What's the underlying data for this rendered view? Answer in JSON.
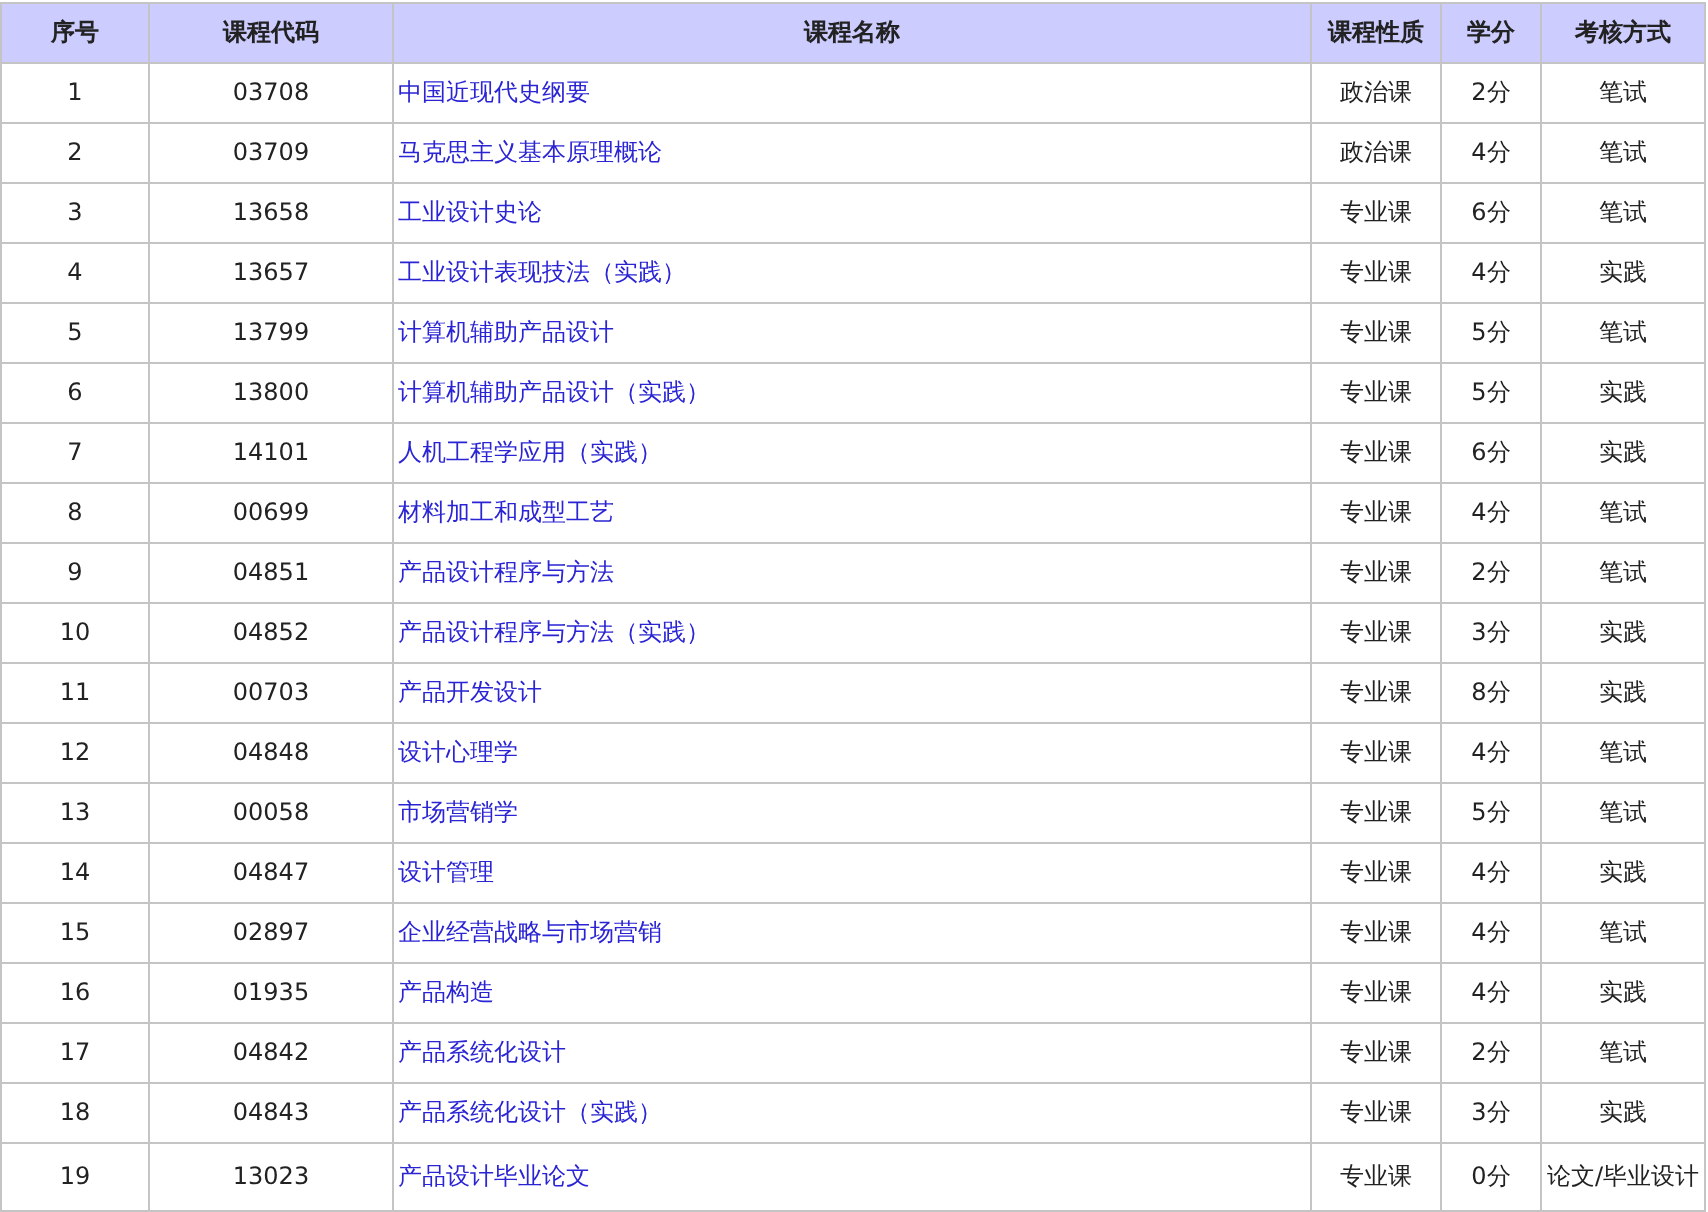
{
  "table": {
    "columns": [
      "序号",
      "课程代码",
      "课程名称",
      "课程性质",
      "学分",
      "考核方式"
    ],
    "rows": [
      [
        "1",
        "03708",
        "中国近现代史纲要",
        "政治课",
        "2分",
        "笔试"
      ],
      [
        "2",
        "03709",
        "马克思主义基本原理概论",
        "政治课",
        "4分",
        "笔试"
      ],
      [
        "3",
        "13658",
        "工业设计史论",
        "专业课",
        "6分",
        "笔试"
      ],
      [
        "4",
        "13657",
        "工业设计表现技法（实践）",
        "专业课",
        "4分",
        "实践"
      ],
      [
        "5",
        "13799",
        "计算机辅助产品设计",
        "专业课",
        "5分",
        "笔试"
      ],
      [
        "6",
        "13800",
        "计算机辅助产品设计（实践）",
        "专业课",
        "5分",
        "实践"
      ],
      [
        "7",
        "14101",
        "人机工程学应用（实践）",
        "专业课",
        "6分",
        "实践"
      ],
      [
        "8",
        "00699",
        "材料加工和成型工艺",
        "专业课",
        "4分",
        "笔试"
      ],
      [
        "9",
        "04851",
        "产品设计程序与方法",
        "专业课",
        "2分",
        "笔试"
      ],
      [
        "10",
        "04852",
        "产品设计程序与方法（实践）",
        "专业课",
        "3分",
        "实践"
      ],
      [
        "11",
        "00703",
        "产品开发设计",
        "专业课",
        "8分",
        "实践"
      ],
      [
        "12",
        "04848",
        "设计心理学",
        "专业课",
        "4分",
        "笔试"
      ],
      [
        "13",
        "00058",
        "市场营销学",
        "专业课",
        "5分",
        "笔试"
      ],
      [
        "14",
        "04847",
        "设计管理",
        "专业课",
        "4分",
        "实践"
      ],
      [
        "15",
        "02897",
        "企业经营战略与市场营销",
        "专业课",
        "4分",
        "笔试"
      ],
      [
        "16",
        "01935",
        "产品构造",
        "专业课",
        "4分",
        "实践"
      ],
      [
        "17",
        "04842",
        "产品系统化设计",
        "专业课",
        "2分",
        "笔试"
      ],
      [
        "18",
        "04843",
        "产品系统化设计（实践）",
        "专业课",
        "3分",
        "实践"
      ],
      [
        "19",
        "13023",
        "产品设计毕业论文",
        "专业课",
        "0分",
        "论文/毕业设计"
      ]
    ]
  }
}
